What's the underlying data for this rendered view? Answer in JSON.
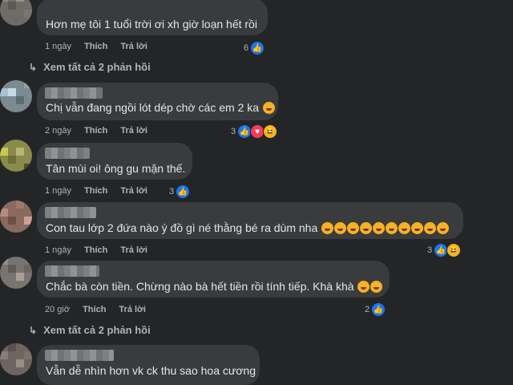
{
  "comments": [
    {
      "text": "Hơn mẹ tôi 1 tuổi trời ơi xh giờ loạn hết rồi",
      "time": "1 ngày",
      "like": "Thích",
      "reply": "Trả lời",
      "react_count": "6",
      "reactions": [
        "like"
      ]
    },
    {
      "text": "Chị vẫn đang ngồi lót dép chờ các em 2 ka",
      "time": "2 ngày",
      "like": "Thích",
      "reply": "Trả lời",
      "react_count": "3",
      "reactions": [
        "like",
        "love",
        "haha"
      ]
    },
    {
      "text": "Tân mùi oi! ông gu mặn thế.",
      "time": "1 ngày",
      "like": "Thích",
      "reply": "Trả lời",
      "react_count": "3",
      "reactions": [
        "like"
      ]
    },
    {
      "text": "Con tau lớp 2 đứa nào ý đồ gì né thằng bé ra dùm nha",
      "time": "1 ngày",
      "like": "Thích",
      "reply": "Trả lời",
      "react_count": "3",
      "reactions": [
        "like",
        "haha"
      ]
    },
    {
      "text": "Chắc bà còn tiền. Chừng nào bà hết tiền rồi tính tiếp. Khà khà",
      "time": "20 giờ",
      "like": "Thích",
      "reply": "Trả lời",
      "react_count": "2",
      "reactions": [
        "like"
      ]
    },
    {
      "text": "Vẫn dễ nhìn hơn vk ck thu sao hoa cương"
    }
  ],
  "view_replies": [
    "Xem tất cả 2 phản hồi",
    "Xem tất cả 2 phản hồi"
  ],
  "colors": {
    "background": "#242526",
    "bubble": "#3a3b3c",
    "text": "#e4e6eb",
    "meta": "#b0b3b8",
    "like": "#1877f2",
    "love": "#f33e58",
    "haha": "#f7b125"
  }
}
